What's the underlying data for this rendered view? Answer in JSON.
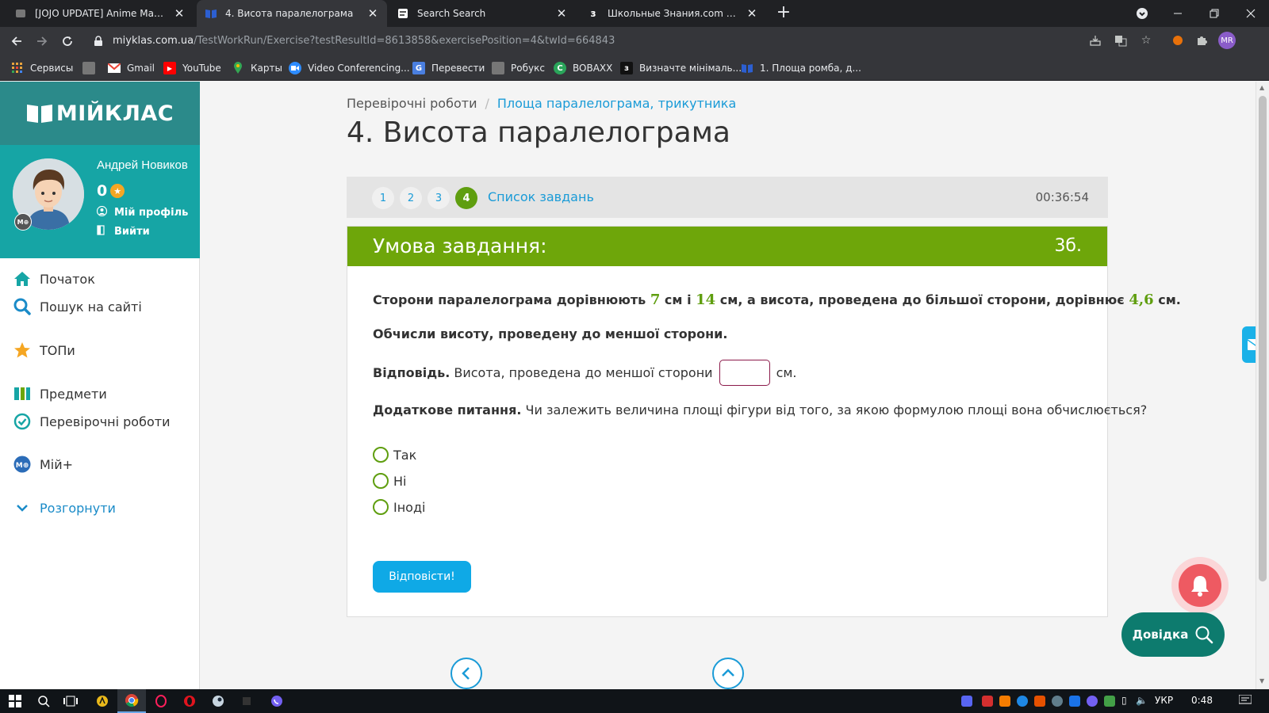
{
  "browser": {
    "tabs": [
      {
        "title": "[JOJO UPDATE] Anime Mania - Ro",
        "active": false
      },
      {
        "title": "4. Висота паралелограма",
        "active": true
      },
      {
        "title": "Search Search",
        "active": false
      },
      {
        "title": "Школьные Знания.com - Решае",
        "active": false
      }
    ],
    "url_host": "miyklas.com.ua",
    "url_path": "/TestWorkRun/Exercise?testResultId=8613858&exercisePosition=4&twId=664843",
    "profile_initials": "MR",
    "bookmarks": [
      {
        "label": "Сервисы",
        "icon": "apps-grid-icon",
        "color": "#e8a33d"
      },
      {
        "label": "",
        "icon": "bookmark-generic-icon",
        "color": "#777777"
      },
      {
        "label": "Gmail",
        "icon": "gmail-icon",
        "color": "#ea4335"
      },
      {
        "label": "YouTube",
        "icon": "youtube-icon",
        "color": "#ff0000"
      },
      {
        "label": "Карты",
        "icon": "maps-pin-icon",
        "color": "#34a853"
      },
      {
        "label": "Video Conferencing...",
        "icon": "video-icon",
        "color": "#2d8cff"
      },
      {
        "label": "Перевести",
        "icon": "translate-icon",
        "color": "#4a7fe0"
      },
      {
        "label": "Робукс",
        "icon": "bookmark-generic-icon",
        "color": "#777777"
      },
      {
        "label": "BOBAXX",
        "icon": "c-logo-icon",
        "color": "#2aa55a"
      },
      {
        "label": "Визначте мінімаль...",
        "icon": "znania-icon",
        "color": "#111111"
      },
      {
        "label": "1. Площа ромба, д...",
        "icon": "book-icon",
        "color": "#2c5fd1"
      }
    ]
  },
  "sidebar": {
    "logo": "МІЙКЛАС",
    "badge": "M⊕",
    "user_name": "Андрей Новиков",
    "points": "0",
    "profile_link": "Мій профіль",
    "logout_link": "Вийти",
    "menu": [
      {
        "label": "Початок",
        "icon": "home-icon"
      },
      {
        "label": "Пошук на сайті",
        "icon": "search-icon"
      },
      {
        "label": "ТОПи",
        "icon": "star-icon"
      },
      {
        "label": "Предмети",
        "icon": "subjects-icon"
      },
      {
        "label": "Перевірочні роботи",
        "icon": "check-circle-icon"
      },
      {
        "label": "Мій+",
        "icon": "my-plus-icon"
      },
      {
        "label": "Розгорнути",
        "icon": "chevron-down-icon"
      }
    ]
  },
  "main": {
    "breadcrumb_root": "Перевірочні роботи",
    "breadcrumb_separator": "/",
    "breadcrumb_current": "Площа паралелограма, трикутника",
    "title": "4. Висота паралелограма",
    "question_numbers": [
      "1",
      "2",
      "3",
      "4"
    ],
    "current_question": "4",
    "task_list_link": "Список завдань",
    "timer": "00:36:54",
    "card_title": "Умова завдання:",
    "card_points": "3б.",
    "q1_part1": "Сторони паралелограма дорівнюють ",
    "q1_num1": "7",
    "q1_part2": " см і ",
    "q1_num2": "14",
    "q1_part3": " см, а висота, проведена до більшої сторони, дорівнює ",
    "q1_num3": "4,6",
    "q1_part4": " см.",
    "q2": "Обчисли висоту, проведену до меншої сторони.",
    "answer_label": "Відповідь.",
    "answer_text": "Висота, проведена до меншої сторони",
    "answer_value": "",
    "answer_unit": "см.",
    "extra_label": "Додаткове питання.",
    "extra_text": " Чи залежить величина площі фігури від того, за якою формулою площі вона обчислюється?",
    "options": [
      "Так",
      "Ні",
      "Іноді"
    ],
    "submit_label": "Відповісти!",
    "help_label": "Довідка"
  },
  "windows_taskbar": {
    "language": "УКР",
    "time": "0:48"
  },
  "colors": {
    "teal_dark": "#2b8a8a",
    "teal": "#16a5a5",
    "green": "#6ea60a",
    "link_blue": "#1a9bd7",
    "submit_blue": "#0fa9e6"
  }
}
